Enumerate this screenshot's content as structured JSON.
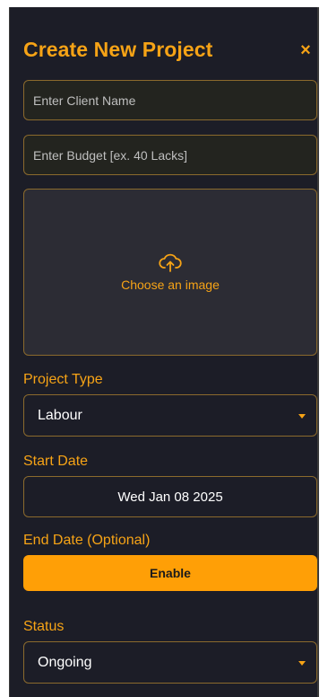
{
  "form": {
    "title": "Create New Project",
    "close_symbol": "×",
    "client_name_placeholder": "Enter Client Name",
    "budget_placeholder": "Enter Budget [ex. 40 Lacks]",
    "upload_label": "Choose an image",
    "upload_icon": "cloud-upload-icon",
    "project_type_label": "Project Type",
    "project_type_value": "Labour",
    "start_date_label": "Start Date",
    "start_date_value": "Wed Jan 08 2025",
    "end_date_label": "End Date (Optional)",
    "enable_label": "Enable",
    "status_label": "Status",
    "status_value": "Ongoing"
  },
  "colors": {
    "accent": "#f6a316",
    "button": "#ff9f06",
    "background": "#1c1d27",
    "border": "#8b6a2d"
  }
}
